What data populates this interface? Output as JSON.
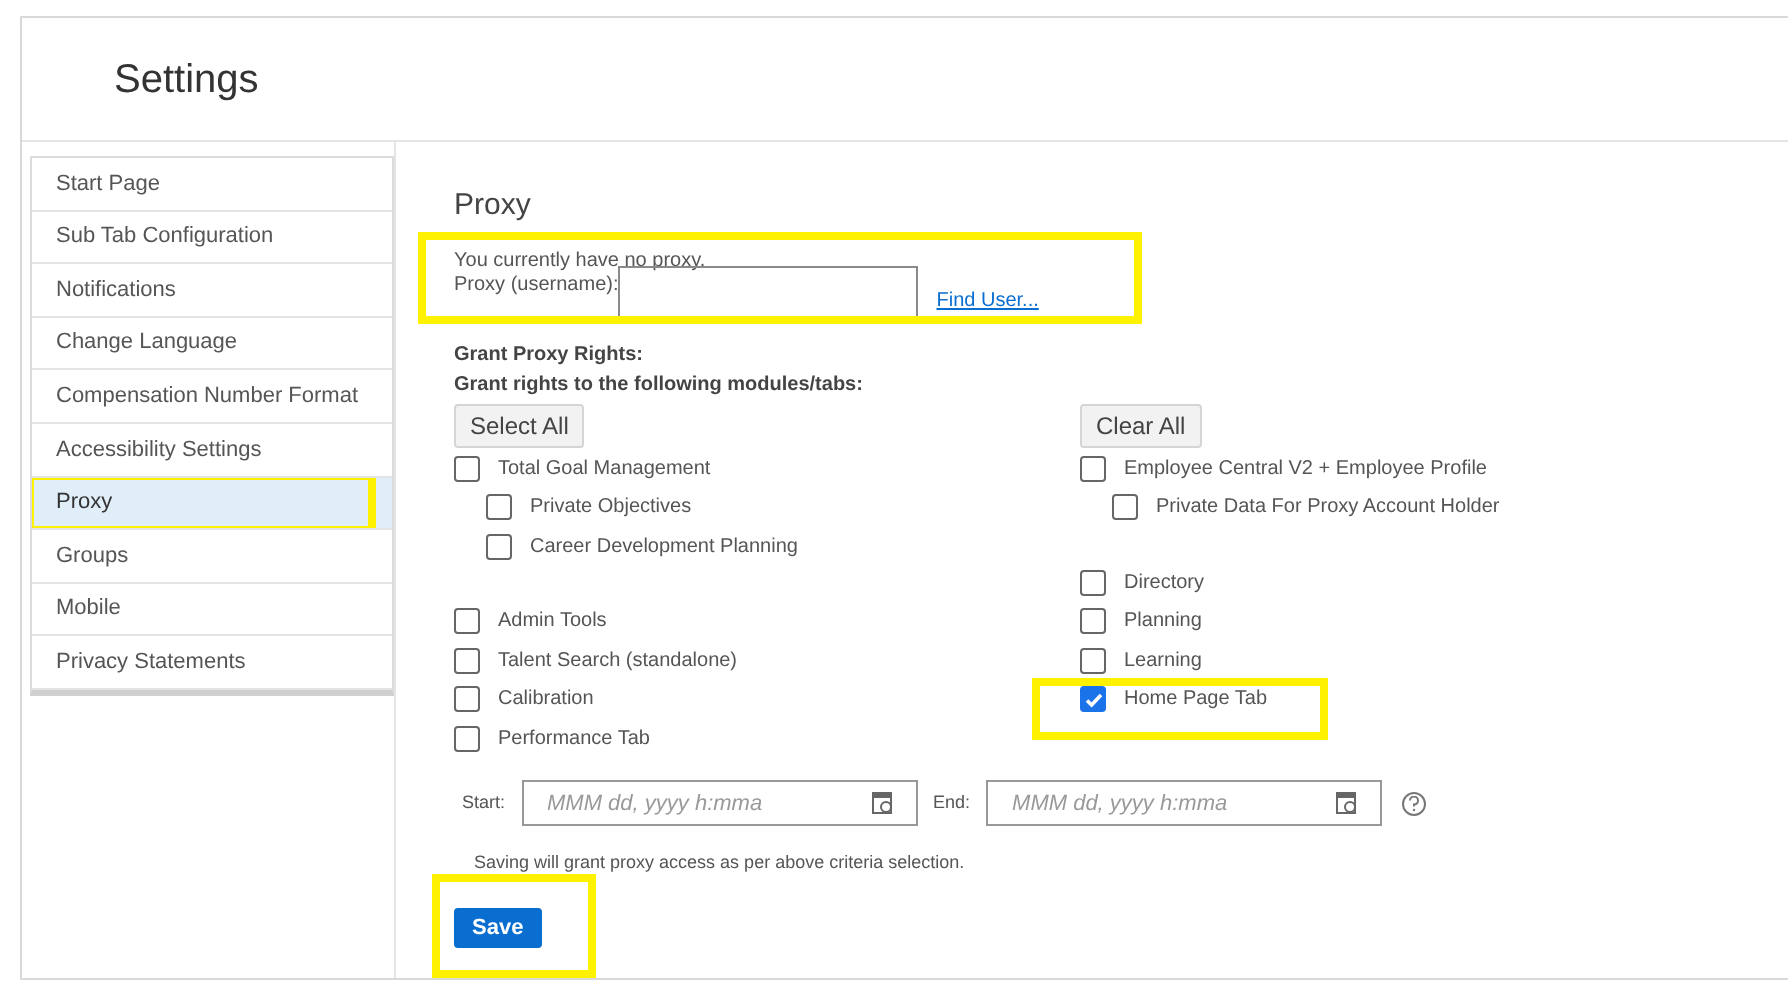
{
  "title": "Settings",
  "sidebar": {
    "items": [
      {
        "label": "Start Page",
        "selected": false,
        "highlighted": false
      },
      {
        "label": "Sub Tab Configuration",
        "selected": false,
        "highlighted": false
      },
      {
        "label": "Notifications",
        "selected": false,
        "highlighted": false
      },
      {
        "label": "Change Language",
        "selected": false,
        "highlighted": false
      },
      {
        "label": "Compensation Number Format",
        "selected": false,
        "highlighted": false
      },
      {
        "label": "Accessibility Settings",
        "selected": false,
        "highlighted": false
      },
      {
        "label": "Proxy",
        "selected": true,
        "highlighted": true
      },
      {
        "label": "Groups",
        "selected": false,
        "highlighted": false
      },
      {
        "label": "Mobile",
        "selected": false,
        "highlighted": false
      },
      {
        "label": "Privacy Statements",
        "selected": false,
        "highlighted": false
      }
    ]
  },
  "proxy": {
    "heading": "Proxy",
    "status": "You currently have no proxy.",
    "username_label": "Proxy (username):",
    "find_user": "Find User...",
    "highlighted": true,
    "rights_heading": "Grant Proxy Rights:",
    "rights_intro": "Grant rights to the following modules/tabs:",
    "select_all": "Select All",
    "clear_all": "Clear All",
    "left_groups": [
      [
        {
          "label": "Total Goal Management",
          "checked": false,
          "highlighted": false,
          "children": [
            {
              "label": "Private Objectives",
              "checked": false,
              "highlighted": false
            },
            {
              "label": "Career Development Planning",
              "checked": false,
              "highlighted": false
            }
          ]
        }
      ],
      [
        {
          "label": "Admin Tools",
          "checked": false,
          "highlighted": false
        },
        {
          "label": "Talent Search (standalone)",
          "checked": false,
          "highlighted": false
        },
        {
          "label": "Calibration",
          "checked": false,
          "highlighted": false
        },
        {
          "label": "Performance Tab",
          "checked": false,
          "highlighted": false
        }
      ]
    ],
    "right_groups": [
      [
        {
          "label": "Employee Central V2 + Employee Profile",
          "checked": false,
          "highlighted": false,
          "children": [
            {
              "label": "Private Data For Proxy Account Holder",
              "checked": false,
              "highlighted": false
            }
          ]
        }
      ],
      [
        {
          "label": "Directory",
          "checked": false,
          "highlighted": false
        },
        {
          "label": "Planning",
          "checked": false,
          "highlighted": false
        },
        {
          "label": "Learning",
          "checked": false,
          "highlighted": false
        },
        {
          "label": "Home Page Tab",
          "checked": true,
          "highlighted": true
        }
      ]
    ],
    "start_label": "Start:",
    "start_placeholder": "MMM dd, yyyy h:mma",
    "end_label": "End:",
    "end_placeholder": "MMM dd, yyyy h:mma",
    "note": "Saving will grant proxy access as per above criteria selection.",
    "save": "Save",
    "save_highlighted": true
  }
}
